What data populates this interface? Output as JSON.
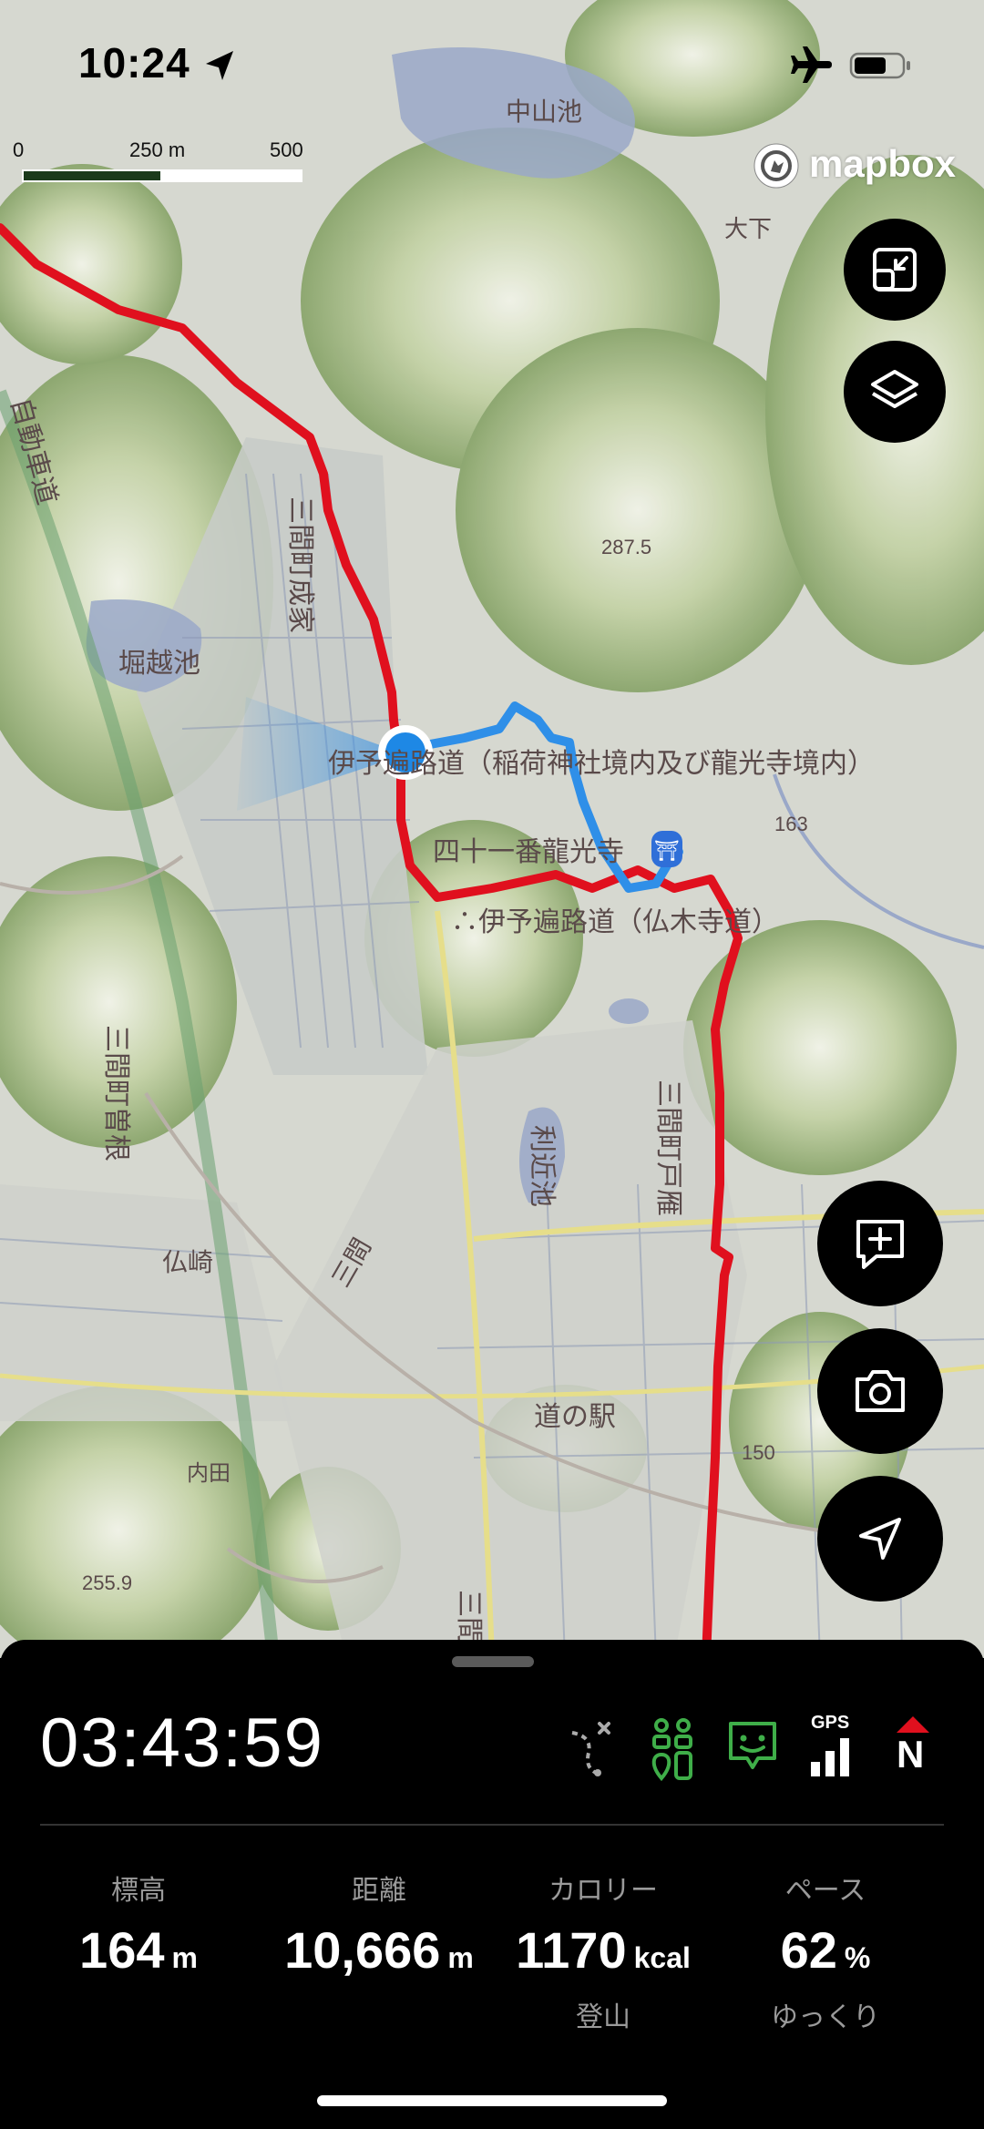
{
  "status_bar": {
    "time": "10:24",
    "location_icon": "location-arrow-icon",
    "airplane_icon": "airplane-icon",
    "battery_icon": "battery-icon"
  },
  "map": {
    "scale_labels": [
      "0",
      "250 m",
      "500 m"
    ],
    "attribution": "mapbox",
    "labels": {
      "pond_nakayama": "中山池",
      "oshita": "大下",
      "town_narie": "三間町成家",
      "pond_horikoshi": "堀越池",
      "road_iyo_1": "伊予遍路道（稲荷神社境内及び龍光寺境内）",
      "temple_41": "四十一番龍光寺",
      "road_iyo_2": "∴伊予遍路道（仏木寺道）",
      "elev_2875": "287.5",
      "elev_163": "163",
      "town_tomo": "三間町戸雁",
      "pond_rika": "利近池",
      "town_sone": "三間町曽根",
      "nisaki": "仏崎",
      "michi_no_eki": "道の駅",
      "elev_150": "150",
      "uchida": "内田",
      "elev_2559": "255.9",
      "mima": "三間",
      "mima2": "三間",
      "doroad": "自動車道"
    },
    "route_colors": {
      "red_route": "#e0101e",
      "blue_track": "#2f8fe8"
    }
  },
  "map_buttons": {
    "fit_icon": "fit-route-icon",
    "layers_icon": "layers-icon",
    "add_note_icon": "add-note-icon",
    "camera_icon": "camera-icon",
    "navigate_icon": "navigate-icon"
  },
  "panel": {
    "elapsed_time": "03:43:59",
    "status_icons": [
      "route-off-icon",
      "companions-icon",
      "chat-icon",
      "gps-signal-icon",
      "compass-north-icon"
    ],
    "gps_label": "GPS",
    "compass_label": "N",
    "stats": [
      {
        "label": "標高",
        "value": "164",
        "unit": "m",
        "sub": ""
      },
      {
        "label": "距離",
        "value": "10,666",
        "unit": "m",
        "sub": ""
      },
      {
        "label": "カロリー",
        "value": "1170",
        "unit": "kcal",
        "sub": "登山"
      },
      {
        "label": "ペース",
        "value": "62",
        "unit": "%",
        "sub": "ゆっくり"
      }
    ]
  },
  "colors": {
    "accent_green": "#3fae49",
    "panel_bg": "#000000",
    "compass_red": "#e0101e"
  }
}
